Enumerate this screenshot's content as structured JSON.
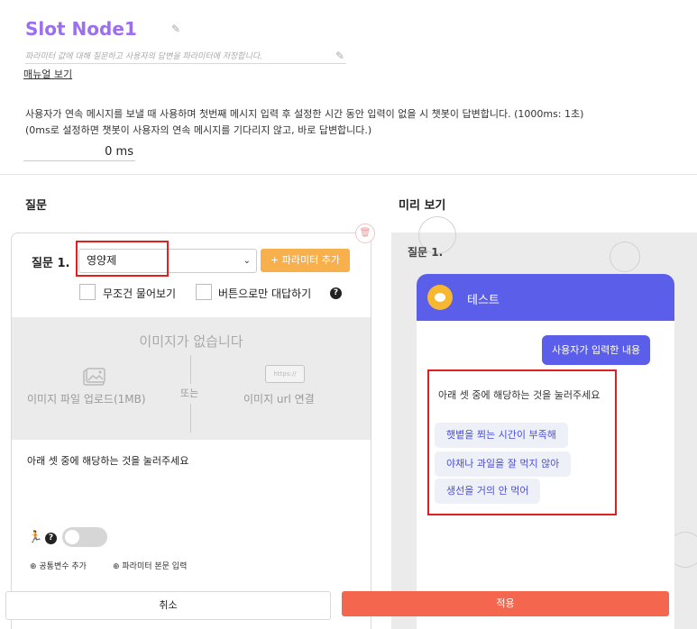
{
  "header": {
    "title": "Slot Node1",
    "description_placeholder": "파라미터 값에 대해 질문하고 사용자의 답변을 파라미터에 저장합니다.",
    "manual_link": "매뉴얼 보기",
    "info_line1": "사용자가 연속 메시지를 보낼 때 사용하며 첫번째 메시지 입력 후 설정한 시간 동안 입력이 없을 시 챗봇이 답변합니다. (1000ms: 1초)",
    "info_line2": "(0ms로 설정하면 챗봇이 사용자의 연속 메시지를 기다리지 않고, 바로 답변합니다.)",
    "delay_value": "0 ms"
  },
  "question_section": {
    "title": "질문",
    "question_label": "질문 1.",
    "selected_param": "영양제",
    "add_param_button": "+ 파라미터 추가",
    "always_ask_label": "무조건 물어보기",
    "button_only_label": "버튼으로만 대답하기",
    "no_image_text": "이미지가 없습니다",
    "upload_label": "이미지 파일 업로드(1MB)",
    "or_label": "또는",
    "url_label": "이미지 url 연결",
    "url_icon_text": "https://",
    "question_text": "아래 셋 중에 해당하는 것을 눌러주세요",
    "add_common_var": "⊕ 공통변수 추가",
    "add_param_body": "⊕ 파라미터 본문 입력",
    "toggle_on": false
  },
  "preview_section": {
    "title": "미리 보기",
    "question_label": "질문 1.",
    "chat_title": "테스트",
    "user_message": "사용자가 입력한 내용",
    "bot_message": "아래 셋 중에 해당하는 것을 눌러주세요",
    "choices": [
      "햇볕을 쬐는 시간이 부족해",
      "야채나 과일을 잘 먹지 않아",
      "생선을 거의 안 먹어"
    ]
  },
  "footer": {
    "cancel_label": "취소",
    "apply_label": "적용"
  },
  "colors": {
    "title_purple": "#9b6ff0",
    "param_button_orange": "#f7b04b",
    "chat_header_blue": "#5b5ee8",
    "apply_red": "#f4664d",
    "highlight_red": "#e02020"
  }
}
